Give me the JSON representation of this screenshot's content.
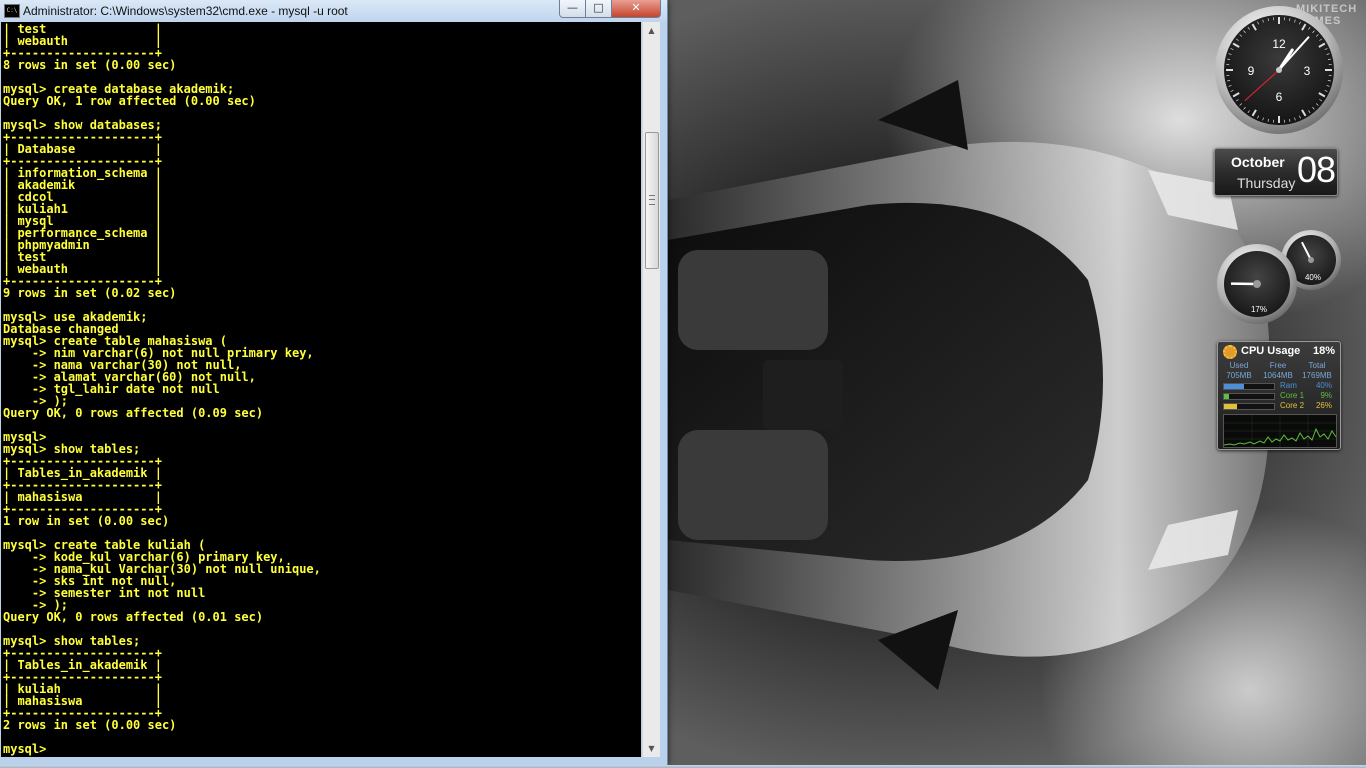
{
  "window": {
    "title": "Administrator: C:\\Windows\\system32\\cmd.exe - mysql  -u root",
    "icon_label": "C:\\",
    "minimize_glyph": "—",
    "maximize_glyph": "□",
    "close_glyph": "✕",
    "scroll_up_glyph": "▲",
    "scroll_down_glyph": "▼"
  },
  "console": {
    "lines": [
      "| test               |",
      "| webauth            |",
      "+--------------------+",
      "8 rows in set (0.00 sec)",
      "",
      "mysql> create database akademik;",
      "Query OK, 1 row affected (0.00 sec)",
      "",
      "mysql> show databases;",
      "+--------------------+",
      "| Database           |",
      "+--------------------+",
      "| information_schema |",
      "| akademik           |",
      "| cdcol              |",
      "| kuliah1            |",
      "| mysql              |",
      "| performance_schema |",
      "| phpmyadmin         |",
      "| test               |",
      "| webauth            |",
      "+--------------------+",
      "9 rows in set (0.02 sec)",
      "",
      "mysql> use akademik;",
      "Database changed",
      "mysql> create table mahasiswa (",
      "    -> nim varchar(6) not null primary key,",
      "    -> nama varchar(30) not null,",
      "    -> alamat varchar(60) not null,",
      "    -> tgl_lahir date not null",
      "    -> );",
      "Query OK, 0 rows affected (0.09 sec)",
      "",
      "mysql>",
      "mysql> show tables;",
      "+--------------------+",
      "| Tables_in_akademik |",
      "+--------------------+",
      "| mahasiswa          |",
      "+--------------------+",
      "1 row in set (0.00 sec)",
      "",
      "mysql> create table kuliah (",
      "    -> kode_kul varchar(6) primary key,",
      "    -> nama_kul Varchar(30) not null unique,",
      "    -> sks int not null,",
      "    -> semester int not null",
      "    -> );",
      "Query OK, 0 rows affected (0.01 sec)",
      "",
      "mysql> show tables;",
      "+--------------------+",
      "| Tables_in_akademik |",
      "+--------------------+",
      "| kuliah             |",
      "| mahasiswa          |",
      "+--------------------+",
      "2 rows in set (0.00 sec)",
      "",
      "mysql> "
    ],
    "text_color": "#ffff3c",
    "background": "#000000"
  },
  "desktop": {
    "brand_watermark": "MIKITECH GAMES",
    "wallpaper": "silver sports car, top view"
  },
  "gadgets": {
    "clock": {
      "numerals": [
        "12",
        "3",
        "6",
        "9"
      ],
      "hour": 1,
      "minute": 7,
      "second": 38
    },
    "calendar": {
      "month": "October",
      "weekday": "Thursday",
      "day": "08"
    },
    "meters": {
      "cpu_percent": "17%",
      "ram_percent": "40%",
      "cpu_value": 17,
      "ram_value": 40
    },
    "cpu_usage": {
      "title": "CPU Usage",
      "total": "18%",
      "memory": [
        {
          "label": "Used",
          "value": "705MB"
        },
        {
          "label": "Free",
          "value": "1064MB"
        },
        {
          "label": "Total",
          "value": "1769MB"
        }
      ],
      "bars": [
        {
          "label": "Ram",
          "value": "40%",
          "fraction": 0.4,
          "color": "#4a8fd8"
        },
        {
          "label": "Core 1",
          "value": "9%",
          "fraction": 0.09,
          "color": "#5fbf3f"
        },
        {
          "label": "Core 2",
          "value": "26%",
          "fraction": 0.26,
          "color": "#e0c238"
        }
      ],
      "graph_color": "#5fbf3f"
    }
  }
}
